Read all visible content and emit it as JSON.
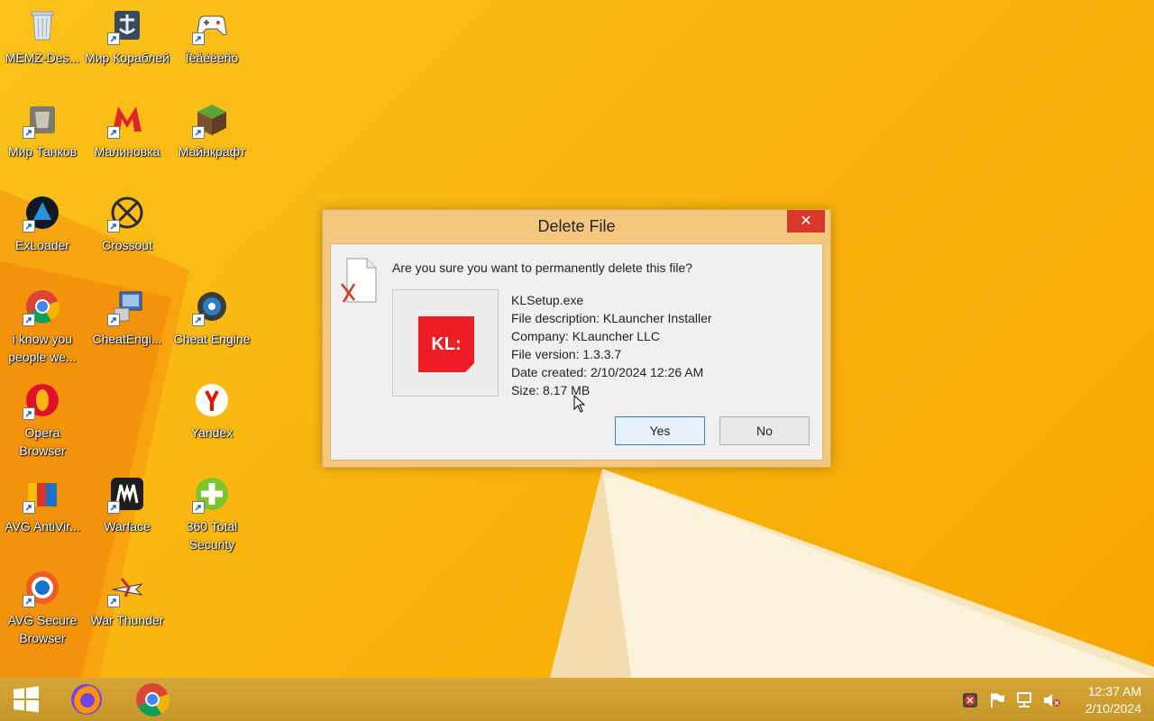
{
  "desktop": {
    "icons": [
      {
        "label": "MEMZ-Des...",
        "icon": "recycle-bin-icon"
      },
      {
        "label": "Мир Кораблей",
        "icon": "world-of-warships-icon"
      },
      {
        "label": "Ïëåéëèñò",
        "icon": "gamepad-icon"
      },
      {
        "label": "Мир Танков",
        "icon": "world-of-tanks-icon"
      },
      {
        "label": "Малиновка",
        "icon": "malinovka-icon"
      },
      {
        "label": "Майнкрафт",
        "icon": "minecraft-icon"
      },
      {
        "label": "ExLoader",
        "icon": "exloader-icon"
      },
      {
        "label": "Crossout",
        "icon": "crossout-icon"
      },
      {
        "label": "i know you people we...",
        "icon": "chrome-icon"
      },
      {
        "label": "CheatEngi...",
        "icon": "cheatengine-folder-icon"
      },
      {
        "label": "Cheat Engine",
        "icon": "cheat-engine-icon"
      },
      {
        "label": "Opera Browser",
        "icon": "opera-icon"
      },
      {
        "label": "Yandex",
        "icon": "yandex-icon"
      },
      {
        "label": "AVG AntiVir...",
        "icon": "avg-antivirus-icon"
      },
      {
        "label": "Warface",
        "icon": "warface-icon"
      },
      {
        "label": "360 Total Security",
        "icon": "360-total-security-icon"
      },
      {
        "label": "AVG Secure Browser",
        "icon": "avg-secure-browser-icon"
      },
      {
        "label": "War Thunder",
        "icon": "war-thunder-icon"
      }
    ]
  },
  "dialog": {
    "title": "Delete File",
    "close_label": "✕",
    "question": "Are you sure you want to permanently delete this file?",
    "file": {
      "name": "KLSetup.exe",
      "description": "File description: KLauncher Installer",
      "company": "Company: KLauncher LLC",
      "version": "File version: 1.3.3.7",
      "created": "Date created: 2/10/2024 12:26 AM",
      "size": "Size: 8.17 MB",
      "logo_text": "KL:"
    },
    "yes_label": "Yes",
    "no_label": "No"
  },
  "taskbar": {
    "pinned": [
      "start-button",
      "firefox",
      "chrome"
    ],
    "clock_time": "12:37 AM",
    "clock_date": "2/10/2024"
  },
  "colors": {
    "wallpaper": "#fab710",
    "dialog_frame": "#f3c87e",
    "close_button": "#d9372b",
    "kl_logo": "#ee1c25"
  }
}
